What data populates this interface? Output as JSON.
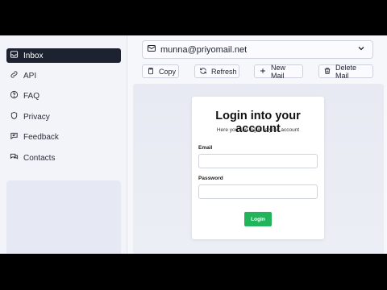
{
  "sidebar": {
    "items": [
      {
        "label": "Inbox",
        "icon": "inbox-icon",
        "active": true
      },
      {
        "label": "API",
        "icon": "link-icon",
        "active": false
      },
      {
        "label": "FAQ",
        "icon": "help-circle-icon",
        "active": false
      },
      {
        "label": "Privacy",
        "icon": "shield-icon",
        "active": false
      },
      {
        "label": "Feedback",
        "icon": "message-icon",
        "active": false
      },
      {
        "label": "Contacts",
        "icon": "chat-icon",
        "active": false
      }
    ]
  },
  "email_selector": {
    "value": "munna@priyomail.net",
    "icon": "mail-icon"
  },
  "toolbar": {
    "copy_label": "Copy",
    "refresh_label": "Refresh",
    "new_mail_label": "New Mail",
    "delete_mail_label": "Delete Mail"
  },
  "login": {
    "title": "Login into your account",
    "subtitle": "Here you can log in to your account",
    "email_label": "Email",
    "password_label": "Password",
    "button_label": "Login",
    "button_color": "#22b45a"
  }
}
